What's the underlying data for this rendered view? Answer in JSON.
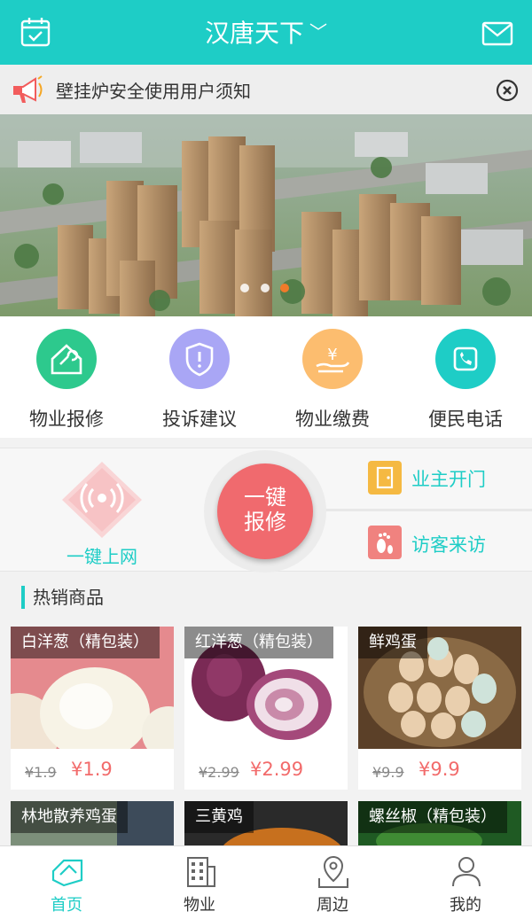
{
  "header": {
    "title": "汉唐天下",
    "calendar_icon": "calendar-check-icon",
    "mail_icon": "mail-icon"
  },
  "notice": {
    "text": "壁挂炉安全使用用户须知"
  },
  "banner": {
    "active_dot": 2,
    "dot_count": 3
  },
  "quick_actions": [
    {
      "label": "物业报修",
      "icon": "house-wrench-icon",
      "color": "#2dc98d"
    },
    {
      "label": "投诉建议",
      "icon": "shield-exclamation-icon",
      "color": "#a9a6f5"
    },
    {
      "label": "物业缴费",
      "icon": "yen-hand-icon",
      "color": "#fcbd6f"
    },
    {
      "label": "便民电话",
      "icon": "phone-icon",
      "color": "#1ecdc6"
    }
  ],
  "mid": {
    "wifi_label": "一键上网",
    "repair_label_1": "一键",
    "repair_label_2": "报修",
    "door_label": "业主开门",
    "visitor_label": "访客来访"
  },
  "hot": {
    "title": "热销商品",
    "products": [
      {
        "name": "白洋葱（精包装）",
        "old": "¥1.9",
        "new": "¥1.9"
      },
      {
        "name": "红洋葱（精包装）",
        "old": "¥2.99",
        "new": "¥2.99"
      },
      {
        "name": "鲜鸡蛋",
        "old": "¥9.9",
        "new": "¥9.9"
      }
    ],
    "products_row2": [
      {
        "name": "林地散养鸡蛋"
      },
      {
        "name": "三黄鸡"
      },
      {
        "name": "螺丝椒（精包装）"
      }
    ]
  },
  "tabs": [
    {
      "label": "首页",
      "icon": "home-icon",
      "active": true
    },
    {
      "label": "物业",
      "icon": "building-icon",
      "active": false
    },
    {
      "label": "周边",
      "icon": "map-pin-icon",
      "active": false
    },
    {
      "label": "我的",
      "icon": "user-icon",
      "active": false
    }
  ],
  "colors": {
    "accent": "#1ecdc6",
    "price": "#f26b6b",
    "repair": "#f06a6e"
  }
}
